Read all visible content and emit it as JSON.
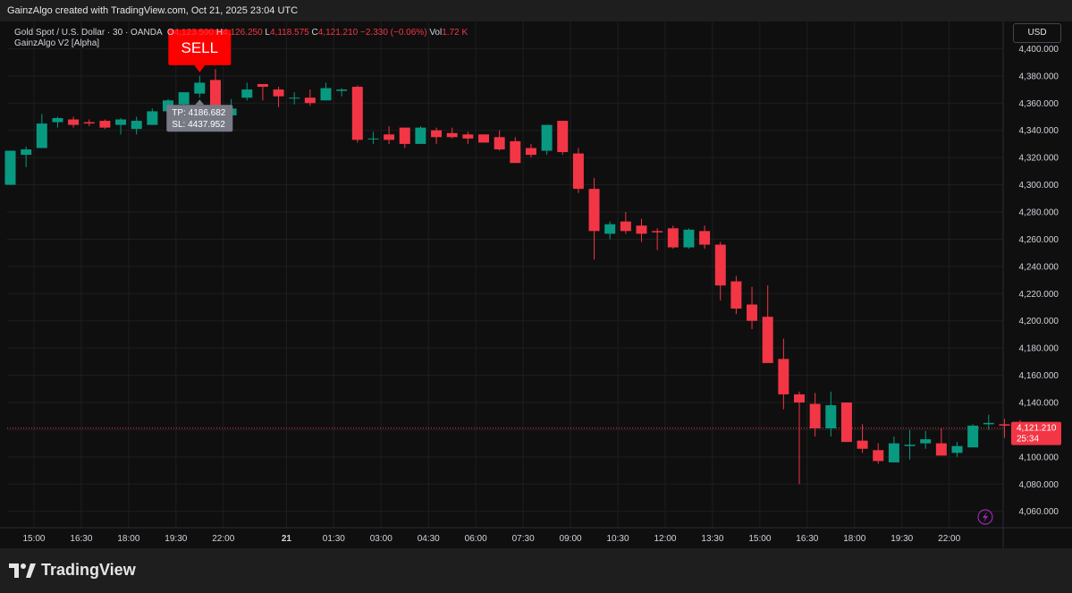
{
  "header": {
    "attribution": "GainzAlgo created with TradingView.com, Oct 21, 2025 23:04 UTC"
  },
  "legend": {
    "symbol": "Gold Spot / U.S. Dollar · 30 · OANDA",
    "open_label": "O",
    "open": "4,123.500",
    "high_label": "H",
    "high": "4,126.250",
    "low_label": "L",
    "low": "4,118.575",
    "close_label": "C",
    "close": "4,121.210",
    "change": "−2.330 (−0.06%)",
    "vol_label": "Vol",
    "vol": "1.72 K",
    "indicator": "GainzAlgo V2 [Alpha]"
  },
  "currency_button": "USD",
  "signal": {
    "label": "SELL",
    "tp": "TP: 4186.682",
    "sl": "SL: 4437.952"
  },
  "price_tag": {
    "price": "4,121.210",
    "countdown": "25:34"
  },
  "footer": {
    "brand": "TradingView"
  },
  "colors": {
    "up": "#089981",
    "down": "#f23645",
    "background": "#0f0f0f",
    "grid": "#1f1f1f",
    "text": "#d1d4dc",
    "signal": "#ff0000"
  },
  "chart_data": {
    "type": "candlestick",
    "symbol": "Gold Spot / U.S. Dollar",
    "interval": "30",
    "y_ticks": [
      "4,400.000",
      "4,380.000",
      "4,360.000",
      "4,340.000",
      "4,320.000",
      "4,300.000",
      "4,280.000",
      "4,260.000",
      "4,240.000",
      "4,220.000",
      "4,200.000",
      "4,180.000",
      "4,160.000",
      "4,140.000",
      "4,120.000",
      "4,100.000",
      "4,080.000",
      "4,060.000"
    ],
    "y_tick_values": [
      4400,
      4380,
      4360,
      4340,
      4320,
      4300,
      4280,
      4260,
      4240,
      4220,
      4200,
      4180,
      4160,
      4140,
      4120,
      4100,
      4080,
      4060
    ],
    "x_ticks": [
      "15:00",
      "16:30",
      "18:00",
      "19:30",
      "22:00",
      "21",
      "01:30",
      "03:00",
      "04:30",
      "06:00",
      "07:30",
      "09:00",
      "10:30",
      "12:00",
      "13:30",
      "15:00",
      "16:30",
      "18:00",
      "19:30",
      "22:00"
    ],
    "x_tick_index": [
      1.5,
      4.5,
      7.5,
      10.5,
      13.5,
      17.5,
      20.5,
      23.5,
      26.5,
      29.5,
      32.5,
      35.5,
      38.5,
      41.5,
      44.5,
      47.5,
      50.5,
      53.5,
      56.5,
      59.5
    ],
    "ylim": [
      4048,
      4420
    ],
    "current_price": 4121.21,
    "sell_signal_index": 12,
    "candles": [
      [
        4300,
        4325,
        4300,
        4325
      ],
      [
        4322,
        4328,
        4313,
        4326
      ],
      [
        4327,
        4352,
        4327,
        4345
      ],
      [
        4346,
        4350,
        4342,
        4349
      ],
      [
        4348,
        4350,
        4342,
        4344
      ],
      [
        4346,
        4348,
        4343,
        4345
      ],
      [
        4347,
        4348,
        4341,
        4342
      ],
      [
        4344,
        4349,
        4337,
        4348
      ],
      [
        4341,
        4350,
        4337,
        4347
      ],
      [
        4344,
        4356,
        4344,
        4354
      ],
      [
        4354,
        4363,
        4354,
        4362
      ],
      [
        4359,
        4367,
        4357,
        4368
      ],
      [
        4367,
        4380,
        4364,
        4375
      ],
      [
        4377,
        4385,
        4364,
        4348
      ],
      [
        4351,
        4363,
        4344,
        4356
      ],
      [
        4364,
        4375,
        4362,
        4370
      ],
      [
        4374,
        4374,
        4362,
        4372
      ],
      [
        4370,
        4372,
        4357,
        4365
      ],
      [
        4364,
        4368,
        4359,
        4364
      ],
      [
        4364,
        4370,
        4358,
        4360
      ],
      [
        4362,
        4375,
        4362,
        4371
      ],
      [
        4369,
        4371,
        4365,
        4370
      ],
      [
        4372,
        4373,
        4331,
        4333
      ],
      [
        4334,
        4339,
        4330,
        4334
      ],
      [
        4337,
        4343,
        4330,
        4333
      ],
      [
        4342,
        4342,
        4327,
        4330
      ],
      [
        4330,
        4343,
        4331,
        4342
      ],
      [
        4340,
        4342,
        4330,
        4335
      ],
      [
        4338,
        4342,
        4334,
        4335
      ],
      [
        4337,
        4339,
        4330,
        4334
      ],
      [
        4337,
        4337,
        4331,
        4331
      ],
      [
        4335,
        4340,
        4325,
        4326
      ],
      [
        4332,
        4335,
        4317,
        4316
      ],
      [
        4327,
        4330,
        4320,
        4322
      ],
      [
        4325,
        4343,
        4322,
        4344
      ],
      [
        4347,
        4347,
        4322,
        4324
      ],
      [
        4323,
        4327,
        4294,
        4297
      ],
      [
        4297,
        4305,
        4245,
        4266
      ],
      [
        4264,
        4273,
        4260,
        4271
      ],
      [
        4273,
        4280,
        4264,
        4266
      ],
      [
        4270,
        4275,
        4258,
        4264
      ],
      [
        4266,
        4268,
        4252,
        4265
      ],
      [
        4268,
        4270,
        4253,
        4254
      ],
      [
        4254,
        4268,
        4253,
        4267
      ],
      [
        4266,
        4270,
        4253,
        4256
      ],
      [
        4256,
        4258,
        4215,
        4226
      ],
      [
        4229,
        4233,
        4205,
        4209
      ],
      [
        4212,
        4225,
        4194,
        4200
      ],
      [
        4203,
        4226,
        4183,
        4169
      ],
      [
        4172,
        4187,
        4135,
        4146
      ],
      [
        4146,
        4148,
        4080,
        4140
      ],
      [
        4139,
        4147,
        4115,
        4121
      ],
      [
        4121,
        4148,
        4115,
        4138
      ],
      [
        4140,
        4140,
        4114,
        4111
      ],
      [
        4112,
        4124,
        4103,
        4106
      ],
      [
        4105,
        4110,
        4095,
        4097
      ],
      [
        4096,
        4115,
        4096,
        4110
      ],
      [
        4108,
        4120,
        4098,
        4109
      ],
      [
        4110,
        4119,
        4106,
        4113
      ],
      [
        4110,
        4121,
        4102,
        4101
      ],
      [
        4103,
        4111,
        4100,
        4108
      ],
      [
        4107,
        4124,
        4108,
        4123
      ],
      [
        4124,
        4131,
        4120,
        4125
      ],
      [
        4124,
        4128,
        4114,
        4123
      ],
      [
        4125,
        4127,
        4118,
        4122
      ],
      [
        4123,
        4126,
        4118,
        4121
      ]
    ]
  }
}
